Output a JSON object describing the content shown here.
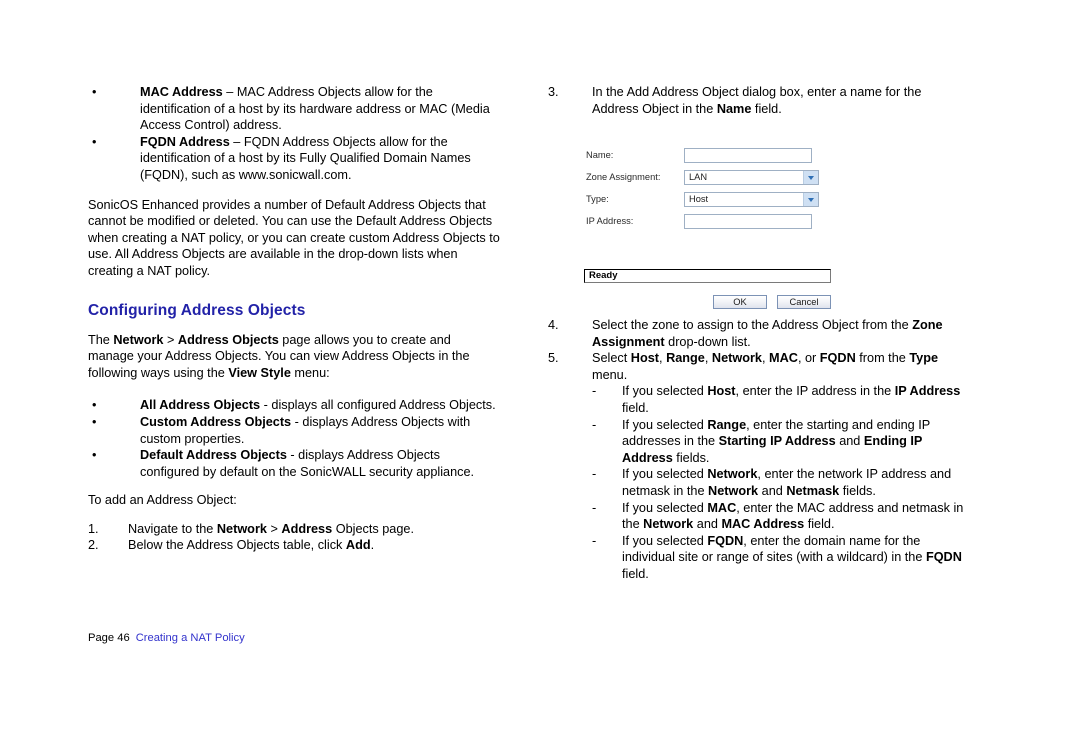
{
  "document": {
    "footer": {
      "page_label": "Page 46",
      "doc_title": "Creating a NAT Policy"
    }
  },
  "left_column": {
    "top_bullets": [
      {
        "marker": "•",
        "term": "MAC Address",
        "dash": " – ",
        "text": "MAC Address Objects allow for the identification of a host by its hardware address or MAC (Media Access Control) address."
      },
      {
        "marker": "•",
        "term": "FQDN Address",
        "dash": " – ",
        "text": "FQDN Address Objects allow for the identification of a host by its Fully Qualified Domain Names (FQDN), such as www.sonicwall.com."
      }
    ],
    "intro_paragraph": "SonicOS Enhanced provides a number of Default Address Objects that cannot be modified or deleted. You can use the Default Address Objects when creating a NAT policy, or you can create custom Address Objects to use. All Address Objects are available in the drop-down lists when creating a NAT policy.",
    "section_heading": "Configuring Address Objects",
    "section_paragraph": {
      "part1": "The ",
      "bold1": "Network",
      "part2": " > ",
      "bold2": "Address Objects",
      "part3": " page allows you to create and manage your Address Objects. You can view Address Objects in the following ways using the ",
      "bold3": "View Style",
      "part4": " menu:"
    },
    "view_style_bullets": [
      {
        "marker": "•",
        "term": "All Address Objects",
        "dash": " - ",
        "text": "displays all configured Address Objects."
      },
      {
        "marker": "•",
        "term": "Custom Address Objects",
        "dash": " - ",
        "text": "displays Address Objects with custom properties."
      },
      {
        "marker": "•",
        "term": "Default Address Objects",
        "dash": " - ",
        "text": "displays Address Objects configured by default on the SonicWALL security appliance."
      }
    ],
    "to_add_lead_in": "To add an Address Object:",
    "steps": [
      {
        "number": "1.",
        "part1": "Navigate to the ",
        "bold1": "Network",
        "part2": " > ",
        "bold2": "Address",
        "part3": " Objects page.",
        "bold3": "",
        "part4": ""
      },
      {
        "number": "2.",
        "part1": "Below the Address Objects table, click ",
        "bold1": "Add",
        "part2": ".",
        "bold2": "",
        "part3": "",
        "bold3": "",
        "part4": ""
      }
    ]
  },
  "right_column": {
    "step3": {
      "number": "3.",
      "part1": "In the Add Address Object dialog box, enter a name for the Address Object in the ",
      "bold1": "Name",
      "part2": " field."
    },
    "step4": {
      "number": "4.",
      "part1": "Select the zone to assign to the Address Object from the ",
      "bold1": "Zone Assignment",
      "part2": " drop-down list."
    },
    "step5": {
      "number": "5.",
      "part1": "Select ",
      "bold1": "Host",
      "part2": ", ",
      "bold2": "Range",
      "part3": ", ",
      "bold3": "Network",
      "part4": ", ",
      "bold4": "MAC",
      "part5": ", or ",
      "bold5": "FQDN",
      "part6": " from the ",
      "bold6": "Type",
      "part7": " menu."
    },
    "step5_sub_items": [
      {
        "marker": "-",
        "part1": "If you selected ",
        "bold1": "Host",
        "part2": ", enter the IP address in the ",
        "bold2": "IP Address",
        "part3": " field.",
        "bold3": "",
        "part4": ""
      },
      {
        "marker": "-",
        "part1": "If you selected ",
        "bold1": "Range",
        "part2": ", enter the starting and ending IP addresses in the ",
        "bold2": "Starting IP Address",
        "part3": " and ",
        "bold3": "Ending IP Address",
        "part4": " fields."
      },
      {
        "marker": "-",
        "part1": "If you selected ",
        "bold1": "Network",
        "part2": ", enter the network IP address and netmask in the ",
        "bold2": "Network",
        "part3": " and ",
        "bold3": "Netmask",
        "part4": " fields."
      },
      {
        "marker": "-",
        "part1": "If you selected ",
        "bold1": "MAC",
        "part2": ", enter the MAC address and netmask in the ",
        "bold2": "Network",
        "part3": " and ",
        "bold3": "MAC Address",
        "part4": " field."
      },
      {
        "marker": "-",
        "part1": "If you selected ",
        "bold1": "FQDN",
        "part2": ", enter the domain name for the individual site or range of sites (with a wildcard) in the ",
        "bold2": "FQDN",
        "part3": " field.",
        "bold3": "",
        "part4": ""
      }
    ]
  },
  "dialog": {
    "fields": {
      "name_label": "Name:",
      "name_value": "",
      "zone_label": "Zone Assignment:",
      "zone_value": "LAN",
      "type_label": "Type:",
      "type_value": "Host",
      "ip_label": "IP Address:",
      "ip_value": ""
    },
    "status_text": "Ready",
    "ok_label": "OK",
    "cancel_label": "Cancel",
    "colors": {
      "select_arrow_button": "#cfe0f3",
      "field_border": "#9fb0c4",
      "button_border": "#7c92b5"
    }
  },
  "theme": {
    "heading_color": "#2222a8",
    "link_color": "#3333cc",
    "text_color": "#000000",
    "page_background": "#ffffff"
  }
}
